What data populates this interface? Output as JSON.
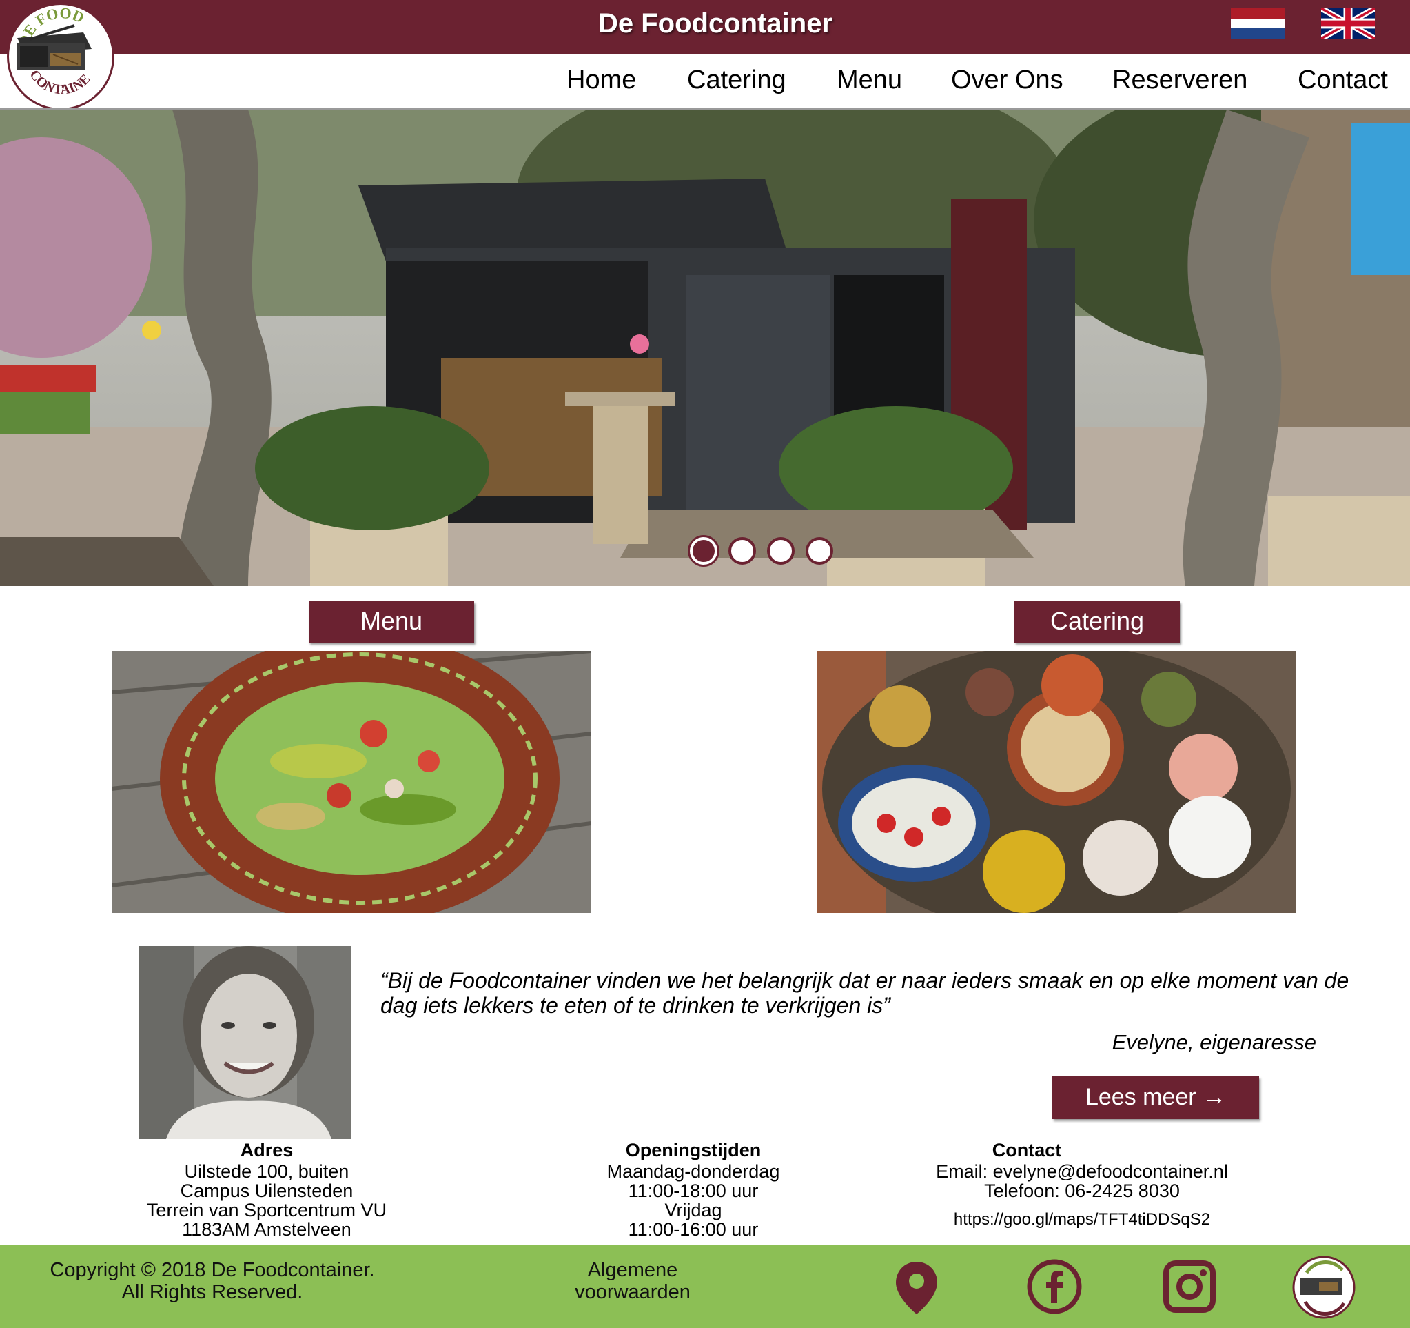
{
  "header": {
    "title": "De Foodcontainer",
    "logo_text_top": "DE FOOD",
    "logo_text_bottom": "CONTAINER",
    "lang_nl": "nl-flag-icon",
    "lang_en": "uk-flag-icon"
  },
  "nav": {
    "items": [
      {
        "label": "Home"
      },
      {
        "label": "Catering"
      },
      {
        "label": "Menu"
      },
      {
        "label": "Over Ons"
      },
      {
        "label": "Reserveren"
      },
      {
        "label": "Contact"
      }
    ]
  },
  "slider": {
    "slide_count": 4,
    "active_index": 0
  },
  "sections": {
    "menu_label": "Menu",
    "catering_label": "Catering"
  },
  "testimonial": {
    "quote": "“Bij de Foodcontainer vinden we het belangrijk dat er naar ieders smaak en op elke moment van de dag iets lekkers te eten of te drinken te verkrijgen is”",
    "author": "Evelyne, eigenaresse",
    "read_more": "Lees meer →"
  },
  "info": {
    "address": {
      "heading": "Adres",
      "lines": [
        "Uilstede 100, buiten",
        "Campus Uilensteden",
        "Terrein van Sportcentrum VU",
        "1183AM Amstelveen"
      ]
    },
    "hours": {
      "heading": "Openingstijden",
      "lines": [
        "Maandag-donderdag",
        "11:00-18:00 uur",
        "Vrijdag",
        "11:00-16:00 uur"
      ]
    },
    "contact": {
      "heading": "Contact",
      "email": "Email: evelyne@defoodcontainer.nl",
      "phone": "Telefoon: 06-2425 8030",
      "maps": "https://goo.gl/maps/TFT4tiDDSqS2"
    }
  },
  "footer": {
    "copyright_line1": "Copyright © 2018 De Foodcontainer.",
    "copyright_line2": "All Rights Reserved.",
    "terms_line1": "Algemene",
    "terms_line2": "voorwaarden",
    "icons": [
      "location-pin-icon",
      "facebook-icon",
      "instagram-icon",
      "logo-icon"
    ],
    "colors": {
      "brand": "#6b2231",
      "footer": "#8cbf55"
    }
  }
}
